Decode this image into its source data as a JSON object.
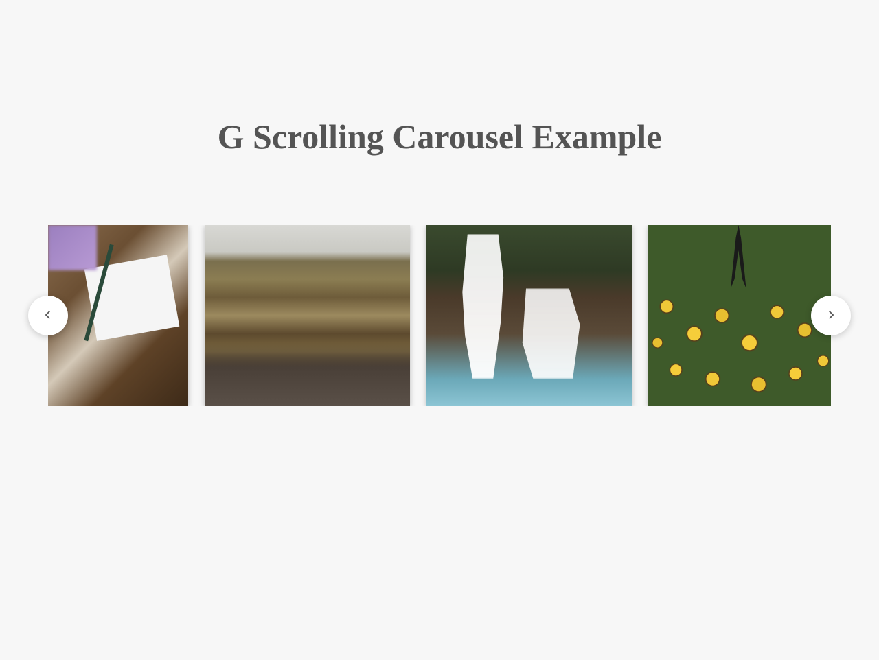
{
  "page": {
    "title": "G Scrolling Carousel Example"
  },
  "carousel": {
    "items": [
      {
        "name": "carousel-item-1"
      },
      {
        "name": "carousel-item-2"
      },
      {
        "name": "carousel-item-3"
      },
      {
        "name": "carousel-item-4"
      }
    ],
    "nav": {
      "prev_aria": "Previous",
      "next_aria": "Next"
    }
  }
}
